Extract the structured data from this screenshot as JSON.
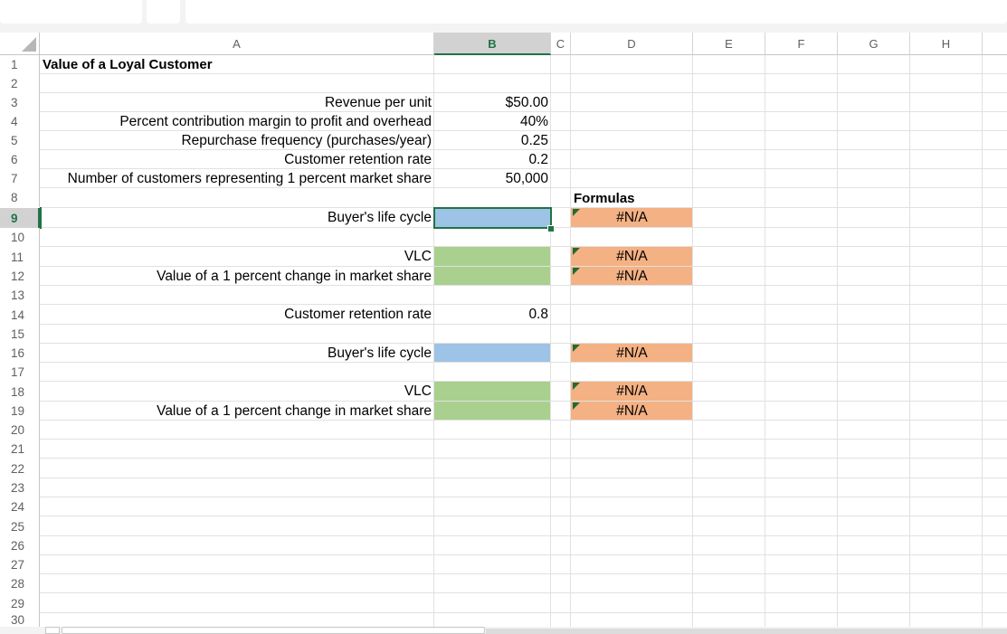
{
  "columns": [
    "A",
    "B",
    "C",
    "D",
    "E",
    "F",
    "G",
    "H"
  ],
  "selected_column": "B",
  "rows": [
    "1",
    "2",
    "3",
    "4",
    "5",
    "6",
    "7",
    "8",
    "9",
    "10",
    "11",
    "12",
    "13",
    "14",
    "15",
    "16",
    "17",
    "18",
    "19",
    "20",
    "21",
    "22",
    "23",
    "24",
    "25",
    "26",
    "27",
    "28",
    "29",
    "30"
  ],
  "selected_row": "9",
  "active_cell": "B9",
  "title": "Value of a Loyal Customer",
  "inputs": {
    "revenue_label": "Revenue per unit",
    "revenue_value": "$50.00",
    "margin_label": "Percent contribution margin to profit and overhead",
    "margin_value": "40%",
    "repurchase_label": "Repurchase frequency (purchases/year)",
    "repurchase_value": "0.25",
    "retention_label": "Customer retention rate",
    "retention_value": "0.2",
    "customers_label": "Number of customers representing 1 percent market share",
    "customers_value": "50,000"
  },
  "formulas_header": "Formulas",
  "block1": {
    "life_cycle_label": "Buyer's life cycle",
    "life_cycle_formula": "#N/A",
    "vlc_label": "VLC",
    "vlc_formula": "#N/A",
    "market_label": "Value of a 1 percent change in market share",
    "market_formula": "#N/A"
  },
  "block2": {
    "retention_label": "Customer retention rate",
    "retention_value": "0.8",
    "life_cycle_label": "Buyer's life cycle",
    "life_cycle_formula": "#N/A",
    "vlc_label": "VLC",
    "vlc_formula": "#N/A",
    "market_label": "Value of a 1 percent change in market share",
    "market_formula": "#N/A"
  },
  "colors": {
    "input_fill": "#9dc3e6",
    "output_fill": "#a9d08e",
    "formula_fill": "#f4b183",
    "accent": "#217346"
  }
}
